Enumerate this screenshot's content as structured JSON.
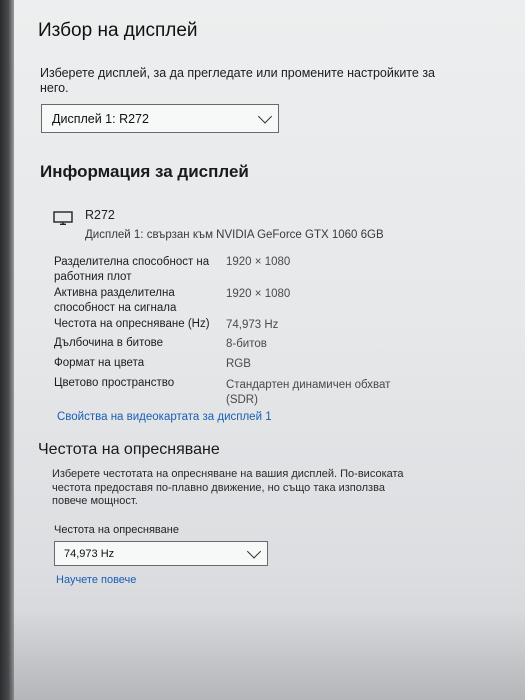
{
  "display_select": {
    "title": "Избор на дисплей",
    "description": "Изберете дисплей, за да прегледате или промените настройките за него.",
    "selected": "Дисплей 1: R272"
  },
  "display_info": {
    "title": "Информация за дисплей",
    "monitor_icon": "monitor-icon",
    "monitor_name": "R272",
    "monitor_subtitle": "Дисплей 1: свързан към NVIDIA GeForce GTX 1060 6GB",
    "rows": [
      {
        "label": "Разделителна способност на работния плот",
        "value": "1920 × 1080"
      },
      {
        "label": "Активна разделителна способност на сигнала",
        "value": "1920 × 1080"
      },
      {
        "label": "Честота на опресняване (Hz)",
        "value": "74,973 Hz"
      },
      {
        "label": "Дълбочина в битове",
        "value": "8-битов"
      },
      {
        "label": "Формат на цвета",
        "value": "RGB"
      },
      {
        "label": "Цветово пространство",
        "value": "Стандартен динамичен обхват (SDR)"
      }
    ],
    "adapter_link": "Свойства на видеокартата за дисплей 1"
  },
  "refresh_rate": {
    "title": "Честота на опресняване",
    "description": "Изберете честотата на опресняване на вашия дисплей. По-високата честота предоставя по-плавно движение, но също така използва повече мощност.",
    "field_label": "Честота на опресняване",
    "selected": "74,973 Hz",
    "learn_more": "Научете повече"
  },
  "colors": {
    "link": "#1a5fb4",
    "background": "#e8eaec"
  }
}
